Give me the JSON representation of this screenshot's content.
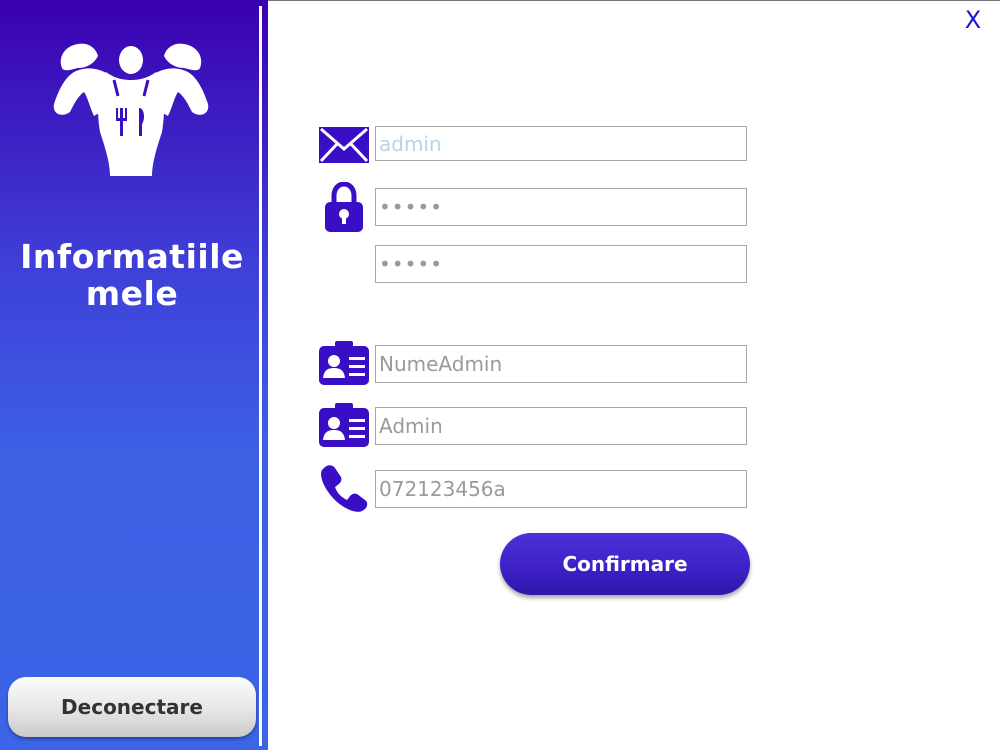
{
  "sidebar": {
    "title": "Informatiile mele",
    "logo": "chef-bodybuilder-logo",
    "logout_label": "Deconectare"
  },
  "window": {
    "close_label": "X"
  },
  "form": {
    "email": {
      "icon": "envelope-icon",
      "value": "admin"
    },
    "password": {
      "icon": "lock-icon",
      "value": "•••••"
    },
    "password_confirm": {
      "value": "•••••"
    },
    "last_name": {
      "icon": "id-card-icon",
      "value": "NumeAdmin"
    },
    "first_name": {
      "icon": "id-card-icon",
      "value": "Admin"
    },
    "phone": {
      "icon": "phone-icon",
      "value": "072123456a"
    },
    "confirm_label": "Confirmare"
  },
  "colors": {
    "accent": "#3a00b0",
    "sidebar_bottom": "#3b64e6",
    "close_x": "#1a14d6"
  }
}
